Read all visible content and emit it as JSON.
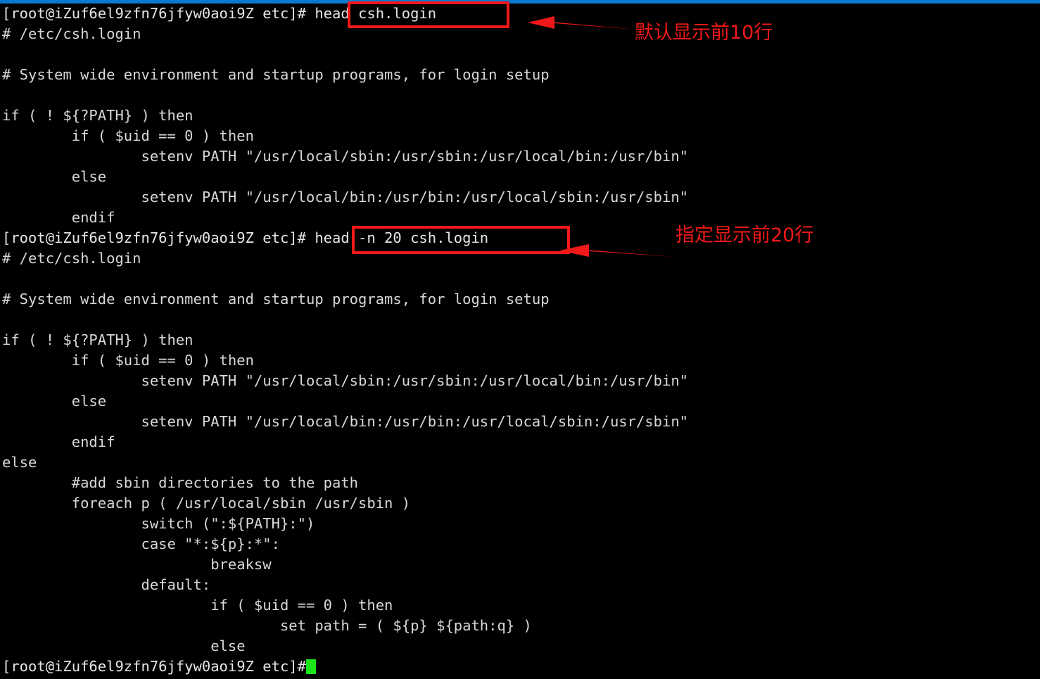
{
  "window": {
    "title": "root@iZuf6el9zfn76jfyw0aoi9Z:/etc",
    "top_border_color": "#0a7ad1",
    "background_color": "#000000",
    "foreground_color": "#d8d8d8",
    "cursor_color": "#19e619",
    "annotation_color": "#f01818"
  },
  "prompt": {
    "user": "root",
    "host": "iZuf6el9zfn76jfyw0aoi9Z",
    "cwd": "etc",
    "text": "[root@iZuf6el9zfn76jfyw0aoi9Z etc]#"
  },
  "commands": {
    "first": "head csh.login",
    "second": "head -n 20 csh.login"
  },
  "annotations": [
    {
      "id": "annotation-default-10-lines",
      "text": "默认显示前10行",
      "boxed_command": "head csh.login"
    },
    {
      "id": "annotation-specify-20-lines",
      "text": "指定显示前20行",
      "boxed_command": "head -n 20 csh.login"
    }
  ],
  "lines": [
    {
      "id": 0,
      "text": "[root@iZuf6el9zfn76jfyw0aoi9Z etc]# head csh.login"
    },
    {
      "id": 1,
      "text": "# /etc/csh.login"
    },
    {
      "id": 2,
      "text": ""
    },
    {
      "id": 3,
      "text": "# System wide environment and startup programs, for login setup"
    },
    {
      "id": 4,
      "text": ""
    },
    {
      "id": 5,
      "text": "if ( ! ${?PATH} ) then"
    },
    {
      "id": 6,
      "text": "        if ( $uid == 0 ) then"
    },
    {
      "id": 7,
      "text": "                setenv PATH \"/usr/local/sbin:/usr/sbin:/usr/local/bin:/usr/bin\""
    },
    {
      "id": 8,
      "text": "        else"
    },
    {
      "id": 9,
      "text": "                setenv PATH \"/usr/local/bin:/usr/bin:/usr/local/sbin:/usr/sbin\""
    },
    {
      "id": 10,
      "text": "        endif"
    },
    {
      "id": 11,
      "text": "[root@iZuf6el9zfn76jfyw0aoi9Z etc]# head -n 20 csh.login"
    },
    {
      "id": 12,
      "text": "# /etc/csh.login"
    },
    {
      "id": 13,
      "text": ""
    },
    {
      "id": 14,
      "text": "# System wide environment and startup programs, for login setup"
    },
    {
      "id": 15,
      "text": ""
    },
    {
      "id": 16,
      "text": "if ( ! ${?PATH} ) then"
    },
    {
      "id": 17,
      "text": "        if ( $uid == 0 ) then"
    },
    {
      "id": 18,
      "text": "                setenv PATH \"/usr/local/sbin:/usr/sbin:/usr/local/bin:/usr/bin\""
    },
    {
      "id": 19,
      "text": "        else"
    },
    {
      "id": 20,
      "text": "                setenv PATH \"/usr/local/bin:/usr/bin:/usr/local/sbin:/usr/sbin\""
    },
    {
      "id": 21,
      "text": "        endif"
    },
    {
      "id": 22,
      "text": "else"
    },
    {
      "id": 23,
      "text": "        #add sbin directories to the path"
    },
    {
      "id": 24,
      "text": "        foreach p ( /usr/local/sbin /usr/sbin )"
    },
    {
      "id": 25,
      "text": "                switch (\":${PATH}:\")"
    },
    {
      "id": 26,
      "text": "                case \"*:${p}:*\":"
    },
    {
      "id": 27,
      "text": "                        breaksw"
    },
    {
      "id": 28,
      "text": "                default:"
    },
    {
      "id": 29,
      "text": "                        if ( $uid == 0 ) then"
    },
    {
      "id": 30,
      "text": "                                set path = ( ${p} ${path:q} )"
    },
    {
      "id": 31,
      "text": "                        else"
    }
  ],
  "final_prompt": {
    "text": "[root@iZuf6el9zfn76jfyw0aoi9Z etc]#",
    "cursor": "block-cursor"
  }
}
